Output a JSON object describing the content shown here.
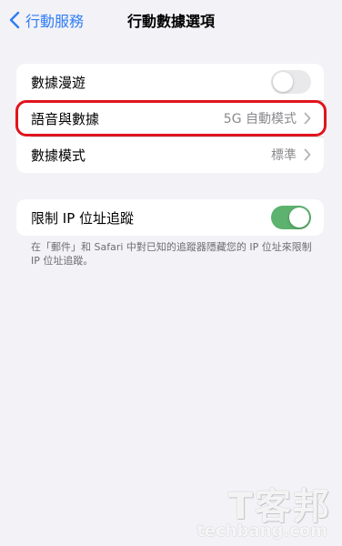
{
  "nav": {
    "back_label": "行動服務",
    "title": "行動數據選項"
  },
  "group1": {
    "rows": [
      {
        "label": "數據漫遊",
        "toggle_on": false
      },
      {
        "label": "語音與數據",
        "value": "5G 自動模式"
      },
      {
        "label": "數據模式",
        "value": "標準"
      }
    ]
  },
  "group2": {
    "rows": [
      {
        "label": "限制 IP 位址追蹤",
        "toggle_on": true
      }
    ],
    "footnote": "在「郵件」和 Safari 中對已知的追蹤器隱藏您的 IP 位址來限制 IP 位址追蹤。"
  },
  "watermark": {
    "big": "T客邦",
    "small": "techbang.com"
  },
  "colors": {
    "accent": "#2f7cf6",
    "toggle_on": "#5cb26e",
    "highlight": "#e0141d"
  },
  "icons": {
    "back": "chevron-left-icon",
    "disclosure": "chevron-right-icon"
  }
}
